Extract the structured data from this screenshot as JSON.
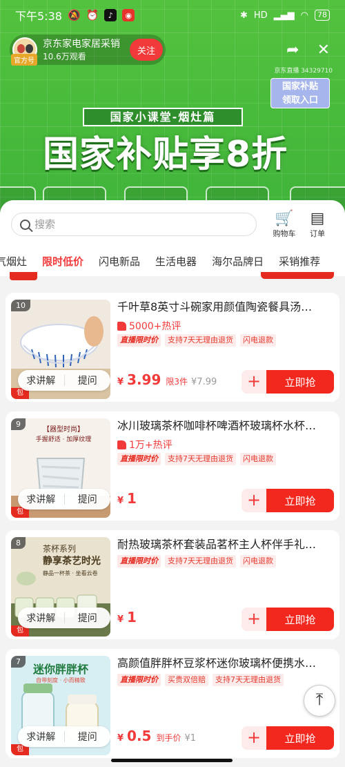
{
  "status_bar": {
    "time": "下午5:38",
    "battery": "78",
    "network": "HD"
  },
  "live_host": {
    "name": "京东家电家居采销",
    "views": "10.6万观看",
    "official_badge": "官方号",
    "follow_label": "关注",
    "room_id": "京东直播 34329710"
  },
  "subsidy_entry": {
    "line1": "国家补贴",
    "line2": "领取入口"
  },
  "banner": {
    "subtitle": "国家小课堂-烟灶篇",
    "title": "国家补贴享8折"
  },
  "shop_header": {
    "search_placeholder": "搜索",
    "cart_label": "购物车",
    "order_label": "订单"
  },
  "tabs": [
    {
      "label": "气烟灶",
      "active": false
    },
    {
      "label": "限时低价",
      "active": true
    },
    {
      "label": "闪电新品",
      "active": false
    },
    {
      "label": "生活电器",
      "active": false
    },
    {
      "label": "海尔品牌日",
      "active": false
    },
    {
      "label": "采销推荐",
      "active": false
    }
  ],
  "products": [
    {
      "rank": "10",
      "title": "千叶草8英寸斗碗家用颜值陶瓷餐具汤…",
      "hot": "5000+热评",
      "tags": [
        "直播限时价",
        "支持7天无理由退货",
        "闪电退款"
      ],
      "price_symbol": "¥",
      "price": "3.99",
      "price_note": "限3件",
      "original_price": "¥7.99",
      "ask_label": "求讲解",
      "question_label": "提问",
      "add_label": "+",
      "buy_label": "立即抢"
    },
    {
      "rank": "9",
      "title": "冰川玻璃茶杯咖啡杯啤酒杯玻璃杯水杯…",
      "hot": "1万+热评",
      "tags": [
        "直播限时价",
        "支持7天无理由退货",
        "闪电退款"
      ],
      "price_symbol": "¥",
      "price": "1",
      "price_note": "",
      "original_price": "",
      "ask_label": "求讲解",
      "question_label": "提问",
      "add_label": "+",
      "buy_label": "立即抢",
      "image_text": [
        "【器型时尚】",
        "手握舒适 · 加厚纹理"
      ]
    },
    {
      "rank": "8",
      "title": "耐热玻璃茶杯套装品茗杯主人杯伴手礼…",
      "hot": "",
      "tags": [
        "直播限时价",
        "支持7天无理由退货",
        "闪电退款"
      ],
      "price_symbol": "¥",
      "price": "1",
      "price_note": "",
      "original_price": "",
      "ask_label": "求讲解",
      "question_label": "提问",
      "add_label": "+",
      "buy_label": "立即抢",
      "image_text": [
        "茶杯系列",
        "静享茶艺时光",
        "静品一杯茶 · 坐看云卷"
      ]
    },
    {
      "rank": "7",
      "title": "高颜值胖胖杯豆浆杯迷你玻璃杯便携水…",
      "hot": "",
      "tags": [
        "直播限时价",
        "买贵双倍赔",
        "支持7天无理由退货"
      ],
      "price_symbol": "¥",
      "price": "0.5",
      "price_note": "到手价",
      "original_price": "¥1",
      "ask_label": "求讲解",
      "question_label": "提问",
      "add_label": "+",
      "buy_label": "立即抢",
      "image_text": [
        "迷你胖胖杯",
        "自带刻度 · 小而精致"
      ]
    }
  ],
  "back_to_top_icon": "arrow-up-icon"
}
